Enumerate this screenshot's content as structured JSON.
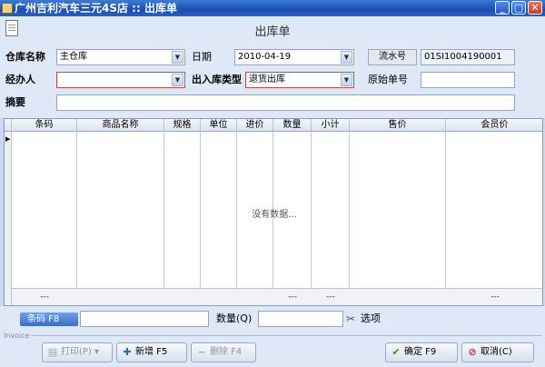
{
  "window": {
    "title": "广州吉利汽车三元4S店 :: 出库单",
    "min": "_",
    "max": "□",
    "close": "✕"
  },
  "form": {
    "heading": "出库单",
    "warehouse_label": "仓库名称",
    "warehouse_value": "主仓库",
    "date_label": "日期",
    "date_value": "2010-04-19",
    "serial_label": "流水号",
    "serial_value": "01SI1004190001",
    "handler_label": "经办人",
    "handler_value": "",
    "type_label": "出入库类型",
    "type_value": "退货出库",
    "orig_label": "原始单号",
    "orig_value": "",
    "memo_label": "摘要",
    "memo_value": ""
  },
  "grid": {
    "columns": [
      "条码",
      "商品名称",
      "规格",
      "单位",
      "进价",
      "数量",
      "小计",
      "售价",
      "会员价"
    ],
    "empty_text": "没有数据...",
    "footer": [
      "---",
      "---",
      "---",
      "---"
    ]
  },
  "bottom": {
    "barcode_label": "条码 F8",
    "barcode_value": "",
    "qty_label": "数量(Q)",
    "qty_value": "",
    "options_label": "选项",
    "invoice_label": "Invoice",
    "print_label": "打印(P)",
    "add_label": "新增 F5",
    "delete_label": "删除 F4",
    "ok_label": "确定 F9",
    "cancel_label": "取消(C)"
  },
  "colors": {
    "titlebar": "#1a4fb0",
    "required_border": "#c84848",
    "grid_header": "#dde3ee"
  }
}
